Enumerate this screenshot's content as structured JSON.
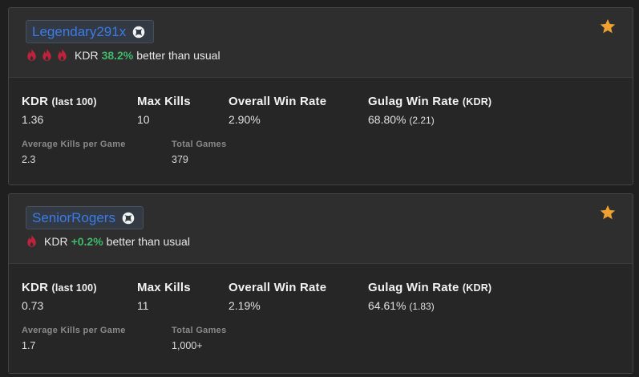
{
  "colors": {
    "accent_link": "#3b7be8",
    "better": "#3fb96b",
    "flame": "#c0223c",
    "star": "#f0a030",
    "card_bg": "#2e2e2e",
    "page_bg": "#1f1f1f"
  },
  "players": [
    {
      "gamertag": "Legendary291x",
      "platform_icon": "xbox-icon",
      "flame_count": 3,
      "kdr_prefix": "KDR",
      "kdr_change": "38.2%",
      "kdr_suffix": "better than usual",
      "favorite_icon": "star-icon",
      "stats": {
        "kdr_label": "KDR",
        "kdr_label_sub": "(last 100)",
        "kdr_value": "1.36",
        "max_kills_label": "Max Kills",
        "max_kills_value": "10",
        "win_rate_label": "Overall Win Rate",
        "win_rate_value": "2.90%",
        "gulag_label": "Gulag Win Rate",
        "gulag_label_sub": "(KDR)",
        "gulag_value": "68.80%",
        "gulag_kdr": "(2.21)",
        "avg_kills_label": "Average Kills per Game",
        "avg_kills_value": "2.3",
        "total_games_label": "Total Games",
        "total_games_value": "379"
      }
    },
    {
      "gamertag": "SeniorRogers",
      "platform_icon": "xbox-icon",
      "flame_count": 1,
      "kdr_prefix": "KDR",
      "kdr_change": "+0.2%",
      "kdr_suffix": "better than usual",
      "favorite_icon": "star-icon",
      "stats": {
        "kdr_label": "KDR",
        "kdr_label_sub": "(last 100)",
        "kdr_value": "0.73",
        "max_kills_label": "Max Kills",
        "max_kills_value": "11",
        "win_rate_label": "Overall Win Rate",
        "win_rate_value": "2.19%",
        "gulag_label": "Gulag Win Rate",
        "gulag_label_sub": "(KDR)",
        "gulag_value": "64.61%",
        "gulag_kdr": "(1.83)",
        "avg_kills_label": "Average Kills per Game",
        "avg_kills_value": "1.7",
        "total_games_label": "Total Games",
        "total_games_value": "1,000+"
      }
    }
  ]
}
